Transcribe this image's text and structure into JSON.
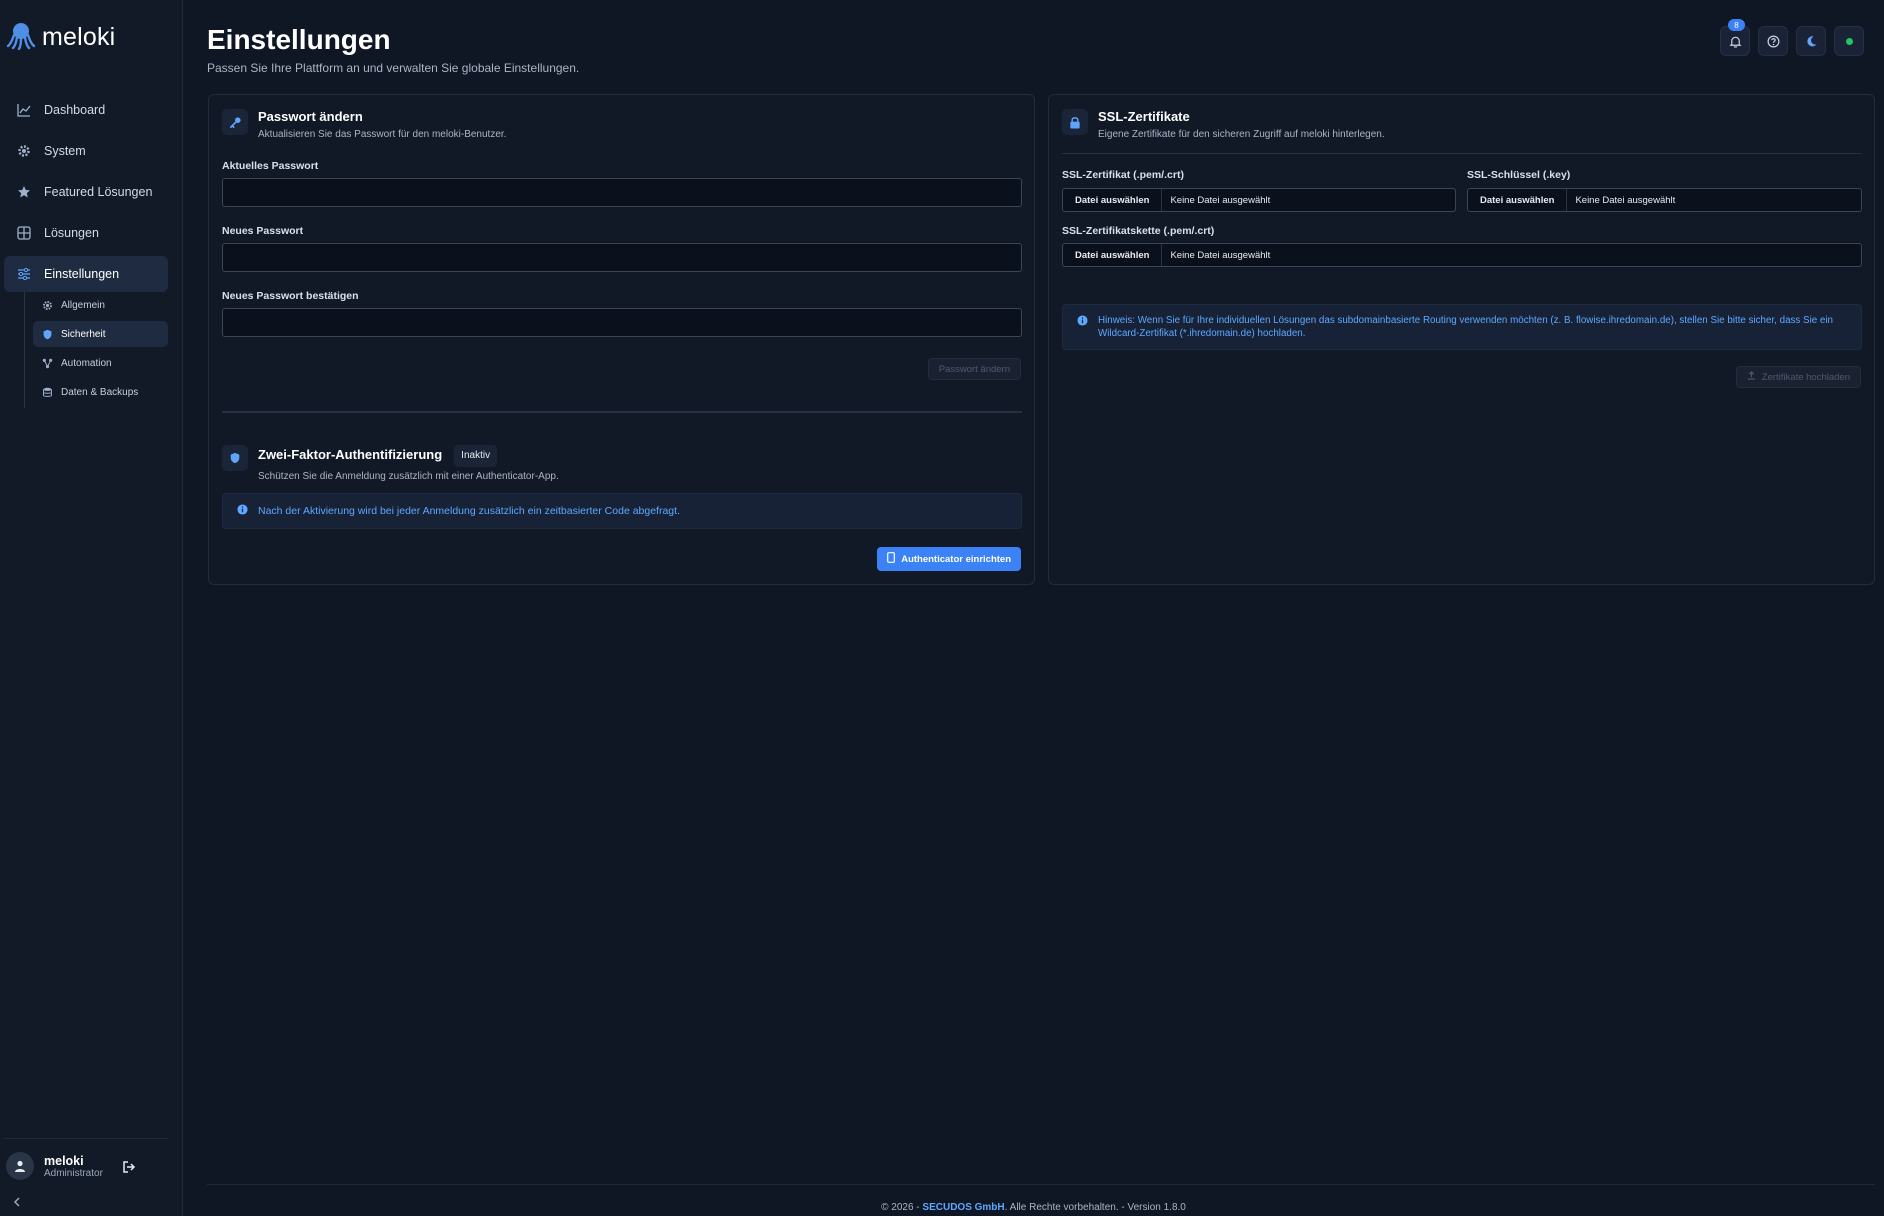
{
  "app": {
    "logo_text": "meloki"
  },
  "sidebar": {
    "items": [
      {
        "label": "Dashboard",
        "icon": "chart-line-icon"
      },
      {
        "label": "System",
        "icon": "gear-icon"
      },
      {
        "label": "Featured Lösungen",
        "icon": "star-icon"
      },
      {
        "label": "Lösungen",
        "icon": "grid-icon"
      },
      {
        "label": "Einstellungen",
        "icon": "sliders-icon",
        "active": true
      }
    ],
    "sub_items": [
      {
        "label": "Allgemein",
        "icon": "gear-icon"
      },
      {
        "label": "Sicherheit",
        "icon": "shield-icon",
        "active": true
      },
      {
        "label": "Automation",
        "icon": "workflow-icon"
      },
      {
        "label": "Daten & Backups",
        "icon": "database-icon"
      }
    ],
    "user": {
      "name": "meloki",
      "role": "Administrator"
    }
  },
  "header": {
    "title": "Einstellungen",
    "subtitle": "Passen Sie Ihre Plattform an und verwalten Sie globale Einstellungen.",
    "notification_count": "8"
  },
  "password": {
    "title": "Passwort ändern",
    "description": "Aktualisieren Sie das Passwort für den meloki-Benutzer.",
    "current_label": "Aktuelles Passwort",
    "new_label": "Neues Passwort",
    "confirm_label": "Neues Passwort bestätigen",
    "submit_label": "Passwort ändern"
  },
  "twofa": {
    "title": "Zwei-Faktor-Authentifizierung",
    "status": "Inaktiv",
    "description": "Schützen Sie die Anmeldung zusätzlich mit einer Authenticator-App.",
    "info": "Nach der Aktivierung wird bei jeder Anmeldung zusätzlich ein zeitbasierter Code abgefragt.",
    "button_label": "Authenticator einrichten"
  },
  "ssl": {
    "title": "SSL-Zertifikate",
    "description": "Eigene Zertifikate für den sicheren Zugriff auf meloki hinterlegen.",
    "cert_label": "SSL-Zertifikat (.pem/.crt)",
    "key_label": "SSL-Schlüssel (.key)",
    "chain_label": "SSL-Zertifikatskette (.pem/.crt)",
    "choose_file": "Datei auswählen",
    "no_file": "Keine Datei ausgewählt",
    "hint": "Hinweis: Wenn Sie für Ihre individuellen Lösungen das subdomainbasierte Routing verwenden möchten (z. B. flowise.ihredomain.de), stellen Sie bitte sicher, dass Sie ein Wildcard-Zertifikat (*.ihredomain.de) hochladen.",
    "upload_label": "Zertifikate hochladen"
  },
  "footer": {
    "prefix": "© 2026 - ",
    "brand": "SECUDOS GmbH",
    "suffix": ". Alle Rechte vorbehalten. - Version 1.8.0"
  },
  "colors": {
    "accent": "#3b82f6",
    "status_online": "#22c55e",
    "background": "#0f1624"
  }
}
